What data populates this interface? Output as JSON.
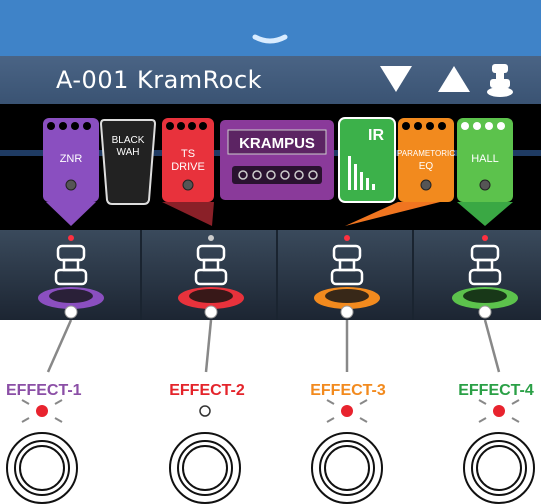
{
  "header": {
    "patch_name": "A-001 KramRock",
    "menu_icon": "chevron-down-icon",
    "down_icon": "triangle-down-icon",
    "up_icon": "triangle-up-icon",
    "tuner_icon": "footswitch-icon"
  },
  "effects": [
    {
      "name": "ZNR",
      "color": "#8a4fc0"
    },
    {
      "name": "BLACK WAH",
      "color": "#222222"
    },
    {
      "name": "TS DRIVE",
      "color": "#e8323c"
    },
    {
      "name": "KRAMPUS",
      "color": "#8a3a9a"
    },
    {
      "name": "IR",
      "color": "#3cb14a"
    },
    {
      "name": "PARAMETORIC EQ",
      "color": "#f28a1e"
    },
    {
      "name": "HALL",
      "color": "#5cc24c"
    }
  ],
  "footswitches": [
    {
      "label": "EFFECT-1",
      "color": "#8b4fa6",
      "led": "off"
    },
    {
      "label": "EFFECT-2",
      "color": "#e4242b",
      "led": "off"
    },
    {
      "label": "EFFECT-3",
      "color": "#f28a1e",
      "led": "on"
    },
    {
      "label": "EFFECT-4",
      "color": "#2aa046",
      "led": "on"
    }
  ]
}
